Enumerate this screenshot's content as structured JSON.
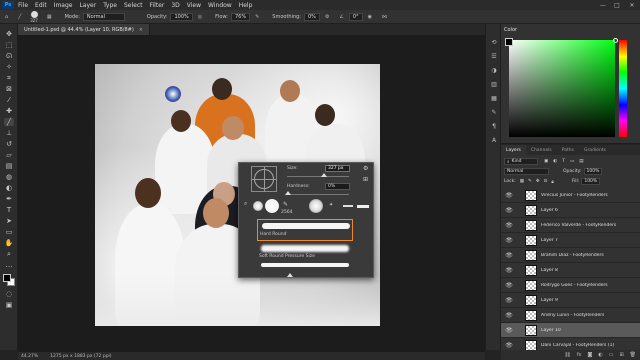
{
  "menubar": {
    "logo": "Ps",
    "items": [
      "File",
      "Edit",
      "Image",
      "Layer",
      "Type",
      "Select",
      "Filter",
      "3D",
      "View",
      "Window",
      "Help"
    ],
    "window_controls": [
      "—",
      "□",
      "✕"
    ]
  },
  "options": {
    "brush_size": "327",
    "mode_label": "Mode:",
    "mode_value": "Normal",
    "opacity_label": "Opacity:",
    "opacity_value": "100%",
    "flow_label": "Flow:",
    "flow_value": "76%",
    "smoothing_label": "Smoothing:",
    "smoothing_value": "0%",
    "angle_value": "0°"
  },
  "document": {
    "tab_title": "Untitled-1.psd @ 44.4% (Layer 10, RGB/8#)",
    "tab_close": "×"
  },
  "brush_picker": {
    "size_label": "Size:",
    "size_value": "327 px",
    "hardness_label": "Hardness:",
    "hardness_value": "0%",
    "tip_size_label": "2564",
    "preset_hard_round": "Hard Round",
    "preset_soft_round": "Soft Round Pressure Size"
  },
  "color_panel": {
    "title": "Color",
    "hue_color": "#00ff12"
  },
  "layers_panel": {
    "tabs": [
      "Layers",
      "Channels",
      "Paths",
      "Gradients"
    ],
    "kind_label": "Kind",
    "blend_mode": "Normal",
    "opacity_label": "Opacity:",
    "opacity_value": "100%",
    "lock_label": "Lock:",
    "fill_label": "Fill:",
    "fill_value": "100%",
    "layers": [
      {
        "name": "Vinícius Júnior - FootyRenders",
        "selected": false
      },
      {
        "name": "Layer 6",
        "selected": false
      },
      {
        "name": "Federico Valverde - FootyRenders",
        "selected": false
      },
      {
        "name": "Layer 7",
        "selected": false
      },
      {
        "name": "Brahim Díaz - FootyRenders",
        "selected": false
      },
      {
        "name": "Layer 8",
        "selected": false
      },
      {
        "name": "Rodrygo Goes - FootyRenders",
        "selected": false
      },
      {
        "name": "Layer 9",
        "selected": false
      },
      {
        "name": "Andriy Lunin - FootyRenders",
        "selected": false
      },
      {
        "name": "Layer 10",
        "selected": true
      },
      {
        "name": "Dani Carvajal - FootyRenders (1)",
        "selected": false
      }
    ]
  },
  "statusbar": {
    "zoom": "44.27%",
    "doc_info": "1275 px x 1883 px (72 ppi)"
  }
}
